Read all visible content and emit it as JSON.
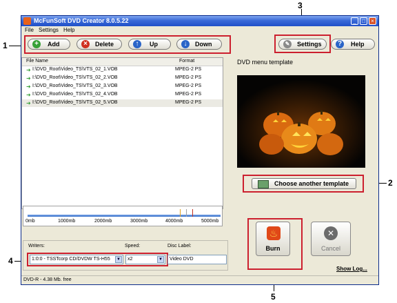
{
  "window": {
    "title": "McFunSoft DVD Creator 8.0.5.22",
    "controls": [
      "_",
      "□",
      "×"
    ]
  },
  "menu": [
    "File",
    "Settings",
    "Help"
  ],
  "toolbar": {
    "add": "Add",
    "delete": "Delete",
    "up": "Up",
    "down": "Down",
    "settings": "Settings",
    "help": "Help"
  },
  "file_list": {
    "columns": [
      "File Name",
      "Format"
    ],
    "rows": [
      {
        "name": "I:\\DVD_Root\\Video_TS\\VTS_02_1.VOB",
        "format": "MPEG-2 PS"
      },
      {
        "name": "I:\\DVD_Root\\Video_TS\\VTS_02_2.VOB",
        "format": "MPEG-2 PS"
      },
      {
        "name": "I:\\DVD_Root\\Video_TS\\VTS_02_3.VOB",
        "format": "MPEG-2 PS"
      },
      {
        "name": "I:\\DVD_Root\\Video_TS\\VTS_02_4.VOB",
        "format": "MPEG-2 PS"
      },
      {
        "name": "I:\\DVD_Root\\Video_TS\\VTS_02_5.VOB",
        "format": "MPEG-2 PS"
      }
    ],
    "selected_index": 4
  },
  "template": {
    "heading": "DVD menu template",
    "choose_label": "Choose another template"
  },
  "size_scale": {
    "ticks": [
      "0mb",
      "1000mb",
      "2000mb",
      "3000mb",
      "4000mb",
      "5000mb"
    ],
    "used_fraction": 0.001
  },
  "burn_settings": {
    "writers_label": "Writers:",
    "speed_label": "Speed:",
    "disc_label_label": "Disc Label:",
    "writer_value": "1:0:0 - TSSTcorp CD/DVDW TS-H55",
    "speed_value": "x2",
    "disc_label_value": "Video DVD"
  },
  "actions": {
    "burn": "Burn",
    "cancel": "Cancel",
    "show_log": "Show Log..."
  },
  "status": "DVD-R - 4.38 Mb. free",
  "callouts": [
    "1",
    "2",
    "3",
    "4",
    "5"
  ],
  "colors": {
    "callout": "#cc1f2e",
    "titlebar": "#1f4fc8"
  }
}
